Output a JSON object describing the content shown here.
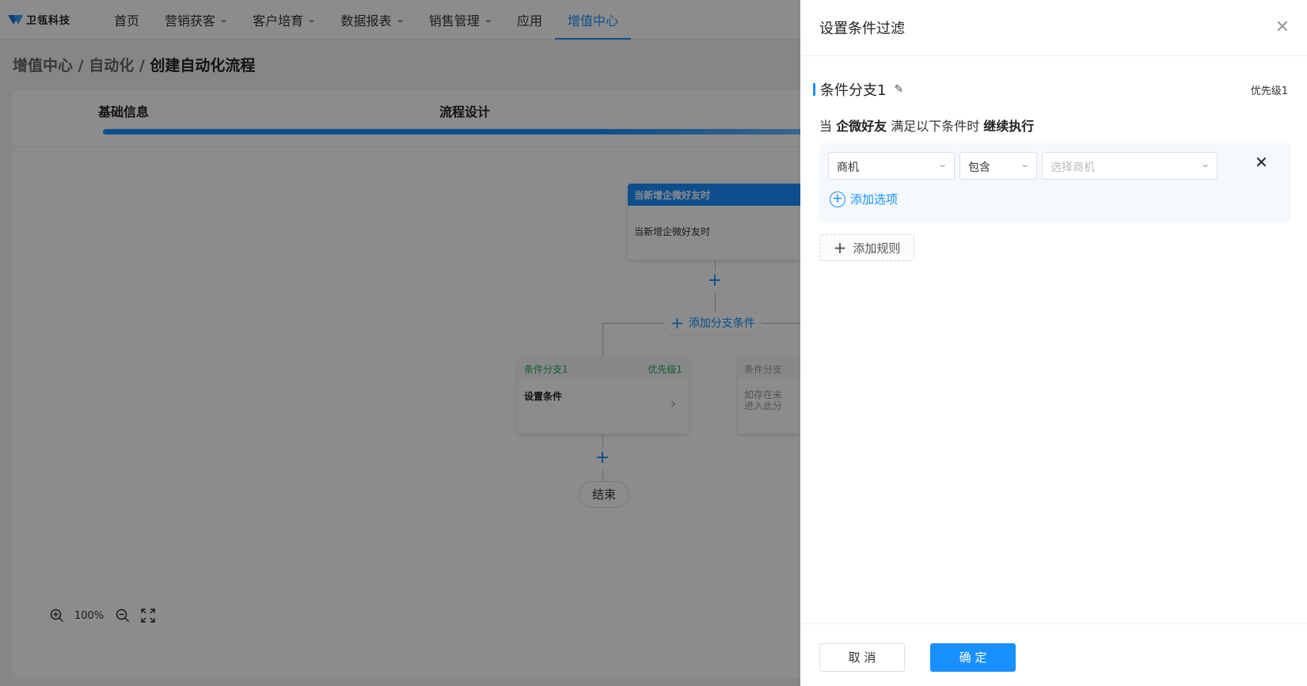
{
  "app": {
    "logo_text": "卫瓴科技"
  },
  "nav": {
    "items": [
      {
        "label": "首页",
        "dropdown": false
      },
      {
        "label": "营销获客",
        "dropdown": true
      },
      {
        "label": "客户培育",
        "dropdown": true
      },
      {
        "label": "数据报表",
        "dropdown": true
      },
      {
        "label": "销售管理",
        "dropdown": true
      },
      {
        "label": "应用",
        "dropdown": false
      },
      {
        "label": "增值中心",
        "dropdown": false,
        "active": true
      }
    ]
  },
  "breadcrumb": {
    "part1": "增值中心",
    "part2": "自动化",
    "current": "创建自动化流程",
    "sep": " / "
  },
  "steps": {
    "step1": "基础信息",
    "step2": "流程设计"
  },
  "flow": {
    "trigger_header": "当新增企微好友时",
    "trigger_body": "当新增企微好友时",
    "add_branch": "添加分支条件",
    "branch1": {
      "name": "条件分支1",
      "priority": "优先级1",
      "body": "设置条件"
    },
    "branch2": {
      "name": "条件分支",
      "body_line1": "如存在未",
      "body_line2": "进入此分"
    },
    "end": "结束"
  },
  "zoom": {
    "level": "100%"
  },
  "drawer": {
    "title": "设置条件过滤",
    "branch_name": "条件分支1",
    "priority": "优先级1",
    "condition": {
      "prefix": "当 ",
      "subject": "企微好友",
      "middle": " 满足以下条件时 ",
      "action": "继续执行"
    },
    "rule": {
      "field": "商机",
      "operator": "包含",
      "value_placeholder": "选择商机"
    },
    "add_option": "添加选项",
    "add_rule": "添加规则",
    "cancel": "取 消",
    "confirm": "确 定"
  },
  "colors": {
    "accent": "#1890ff",
    "green": "#27ae60"
  }
}
